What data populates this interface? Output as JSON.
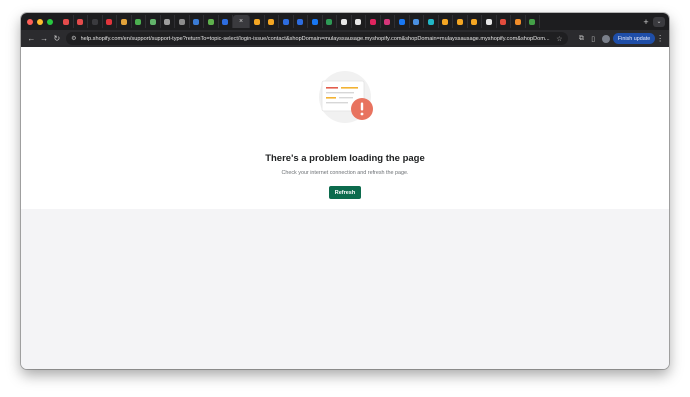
{
  "browser": {
    "traffic_lights": {
      "close": "#fe5f57",
      "minimize": "#febc2e",
      "zoom": "#28c840"
    },
    "tabs": [
      {
        "icon": "shopify-favicon",
        "color": "#e44b4b"
      },
      {
        "icon": "shopify-favicon",
        "color": "#e44b4b"
      },
      {
        "icon": "blank-favicon",
        "color": "#3a3a3e"
      },
      {
        "icon": "opera-favicon",
        "color": "#e1353c"
      },
      {
        "icon": "tool-favicon",
        "color": "#e3a33a"
      },
      {
        "icon": "chart-favicon",
        "color": "#4caf50"
      },
      {
        "icon": "percent-favicon",
        "color": "#62b46b"
      },
      {
        "icon": "caret-favicon",
        "color": "#9e9e9e"
      },
      {
        "icon": "circle-favicon",
        "color": "#8c8c8c"
      },
      {
        "icon": "blue-favicon",
        "color": "#3a7bd5"
      },
      {
        "icon": "green-favicon",
        "color": "#5fb14d"
      },
      {
        "icon": "meta-favicon",
        "color": "#2d6cdf"
      },
      {
        "icon": "active-tab",
        "color": "#3a3a3e"
      },
      {
        "icon": "bolt-favicon",
        "color": "#f4a623"
      },
      {
        "icon": "bolt-favicon",
        "color": "#f4a623"
      },
      {
        "icon": "meta-favicon",
        "color": "#2d6cdf"
      },
      {
        "icon": "meta-favicon",
        "color": "#2d6cdf"
      },
      {
        "icon": "facebook-favicon",
        "color": "#1877f2"
      },
      {
        "icon": "green-square-favicon",
        "color": "#2e9a55"
      },
      {
        "icon": "threads-favicon",
        "color": "#e6e6e6"
      },
      {
        "icon": "threads-favicon",
        "color": "#e6e6e6"
      },
      {
        "icon": "red-favicon",
        "color": "#e0245e"
      },
      {
        "icon": "instagram-favicon",
        "color": "#d6367a"
      },
      {
        "icon": "facebook-favicon",
        "color": "#1877f2"
      },
      {
        "icon": "blue-circle-favicon",
        "color": "#4a90e2"
      },
      {
        "icon": "teal-favicon",
        "color": "#22b7c7"
      },
      {
        "icon": "bars-favicon",
        "color": "#f4a623"
      },
      {
        "icon": "bars-favicon",
        "color": "#f4a623"
      },
      {
        "icon": "bars-favicon",
        "color": "#f4a623"
      },
      {
        "icon": "y-favicon",
        "color": "#e6e6e6"
      },
      {
        "icon": "gmail-favicon",
        "color": "#e24c3d"
      },
      {
        "icon": "orange-circle-favicon",
        "color": "#f08c2a"
      },
      {
        "icon": "pin-favicon",
        "color": "#43a047"
      }
    ],
    "active_tab_close": "×",
    "new_tab_label": "+",
    "tab_menu_label": "⌄",
    "url": "help.shopify.com/en/support/support-type?returnTo=topic-select/login-issue/contact&shopDomain=mulayssausage.myshopify.com&shopDomain=mulayssausage.myshopify.com&shopDom...",
    "finish_update_label": "Finish update",
    "nav": {
      "back": "←",
      "forward": "→",
      "reload": "↻"
    },
    "tune_icon": "⚙",
    "star_icon": "☆",
    "extensions_icon": "⧉",
    "sidepanel_icon": "▯",
    "menu_icon": "⋮"
  },
  "page": {
    "title": "There's a problem loading the page",
    "message": "Check your internet connection and refresh the page.",
    "refresh_label": "Refresh",
    "accent_color": "#0c6b4d",
    "alert_color": "#e8735f"
  }
}
